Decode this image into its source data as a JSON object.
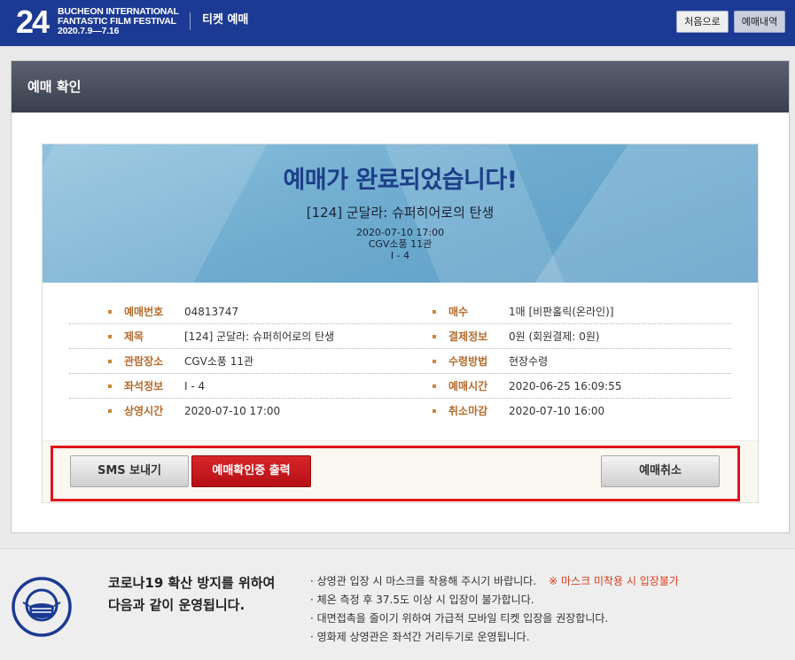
{
  "header": {
    "logo_number": "24",
    "logo_lines": [
      "BUCHEON INTERNATIONAL",
      "FANTASTIC FILM FESTIVAL",
      "2020.7.9—7.16"
    ],
    "title": "티켓 예매",
    "home_button": "처음으로",
    "history_button": "예매내역"
  },
  "panel": {
    "title": "예매 확인"
  },
  "hero": {
    "title": "예매가 완료되었습니다!",
    "movie": "[124] 군달라: 슈퍼히어로의 탄생",
    "datetime": "2020-07-10 17:00",
    "venue": "CGV소풍 11관",
    "seat": "I - 4"
  },
  "details": {
    "rows": [
      {
        "left_label": "예매번호",
        "left_value": "04813747",
        "right_label": "매수",
        "right_value": "1매 [비판홀릭(온라인)]"
      },
      {
        "left_label": "제목",
        "left_value": "[124] 군달라: 슈퍼히어로의 탄생",
        "right_label": "결제정보",
        "right_value": "0원 (회원결제: 0원)"
      },
      {
        "left_label": "관람장소",
        "left_value": "CGV소풍 11관",
        "right_label": "수령방법",
        "right_value": "현장수령"
      },
      {
        "left_label": "좌석정보",
        "left_value": "I - 4",
        "right_label": "예매시간",
        "right_value": "2020-06-25 16:09:55"
      },
      {
        "left_label": "상영시간",
        "left_value": "2020-07-10 17:00",
        "right_label": "취소마감",
        "right_value": "2020-07-10 16:00"
      }
    ]
  },
  "actions": {
    "sms": "SMS 보내기",
    "certificate": "예매확인증 출력",
    "cancel": "예매취소"
  },
  "notice": {
    "title_line1": "코로나19 확산 방지를 위하여",
    "title_line2": "다음과 같이 운영됩니다.",
    "items": [
      "· 상영관 입장 시 마스크를 착용해 주시기 바랍니다.",
      "· 체온 측정 후 37.5도 이상 시 입장이 불가합니다.",
      "· 대면접촉을 줄이기 위하여 가급적 모바일 티켓 입장을 권장합니다.",
      "· 영화제 상영관은 좌석간 거리두기로 운영됩니다."
    ],
    "warning": "※ 마스크 미착용 시 입장불가"
  },
  "colors": {
    "header_bg": "#1c3a93",
    "accent_label": "#b36b2c",
    "primary_red": "#c41a1f",
    "hero_title": "#1d3f88",
    "warning": "#d9401c"
  }
}
